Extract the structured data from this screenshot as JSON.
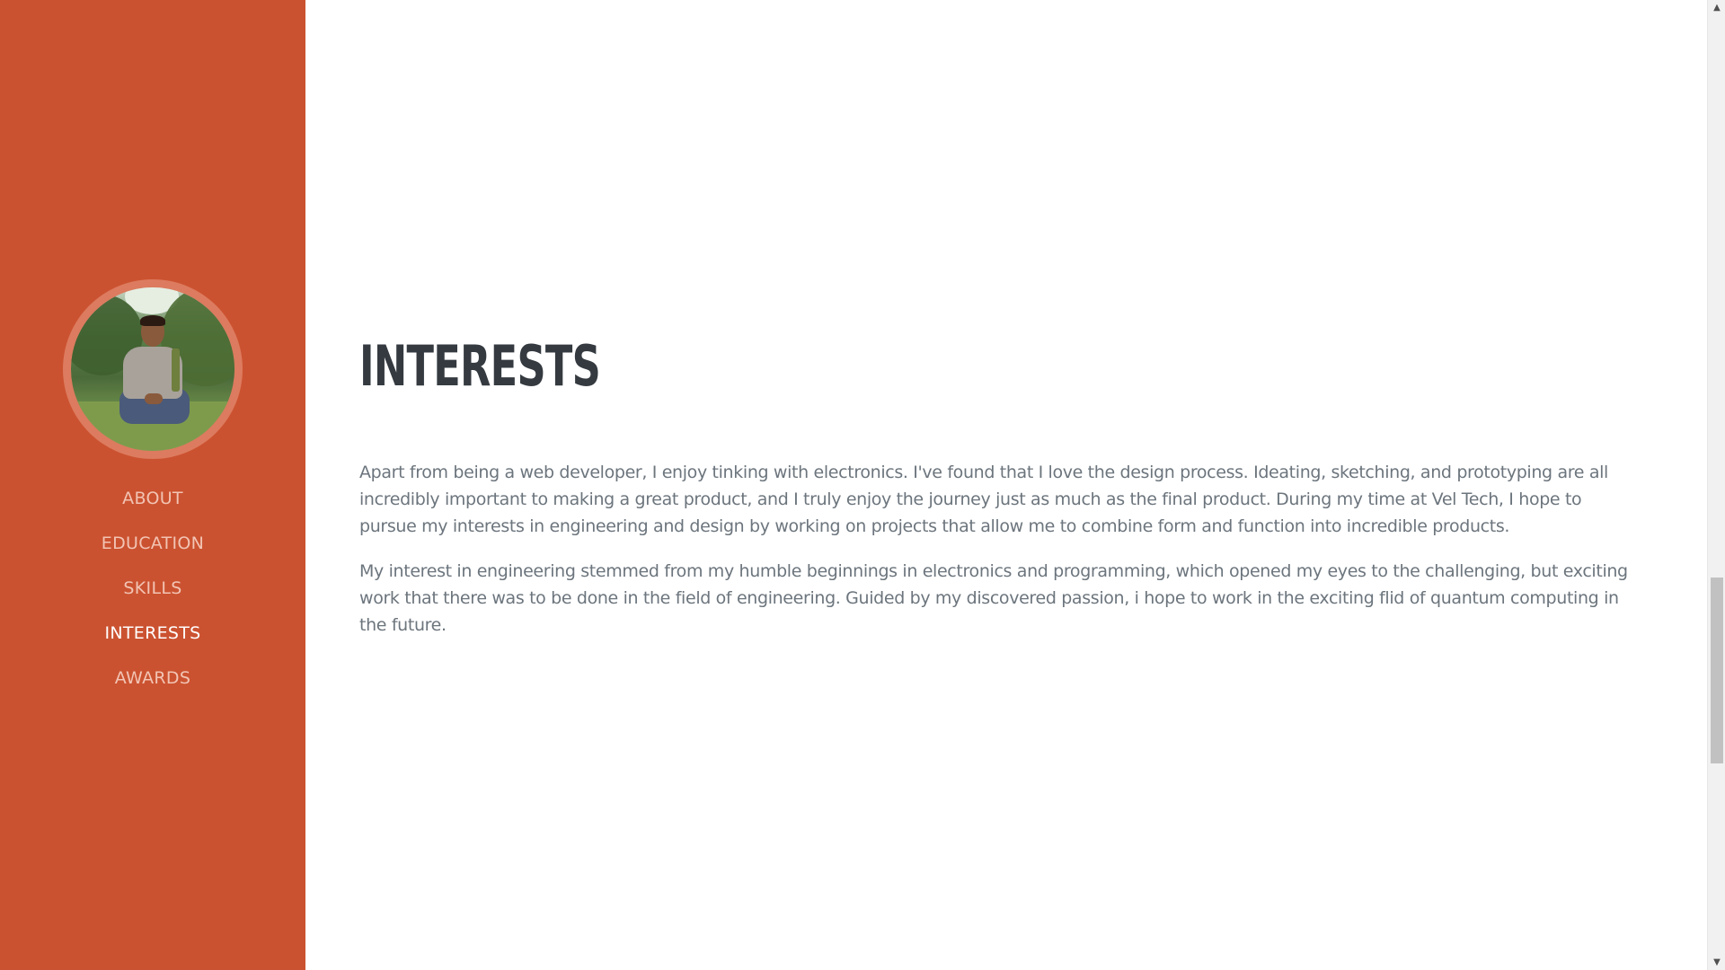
{
  "sidebar": {
    "background_color": "#cb5230",
    "avatar": {
      "alt": "profile photo",
      "ring_color": "#dc7b5f"
    },
    "nav": [
      {
        "label": "ABOUT",
        "active": false
      },
      {
        "label": "EDUCATION",
        "active": false
      },
      {
        "label": "SKILLS",
        "active": false
      },
      {
        "label": "INTERESTS",
        "active": true
      },
      {
        "label": "AWARDS",
        "active": false
      }
    ]
  },
  "main": {
    "section_title": "Interests",
    "paragraphs": [
      "Apart from being a web developer, I enjoy tinking with electronics. I've found that I love the design process. Ideating, sketching, and prototyping are all incredibly important to making a great product, and I truly enjoy the journey just as much as the final product. During my time at Vel Tech, I hope to pursue my interests in engineering and design by working on projects that allow me to combine form and function into incredible products.",
      "My interest in engineering stemmed from my humble beginnings in electronics and programming, which opened my eyes to the challenging, but exciting work that there was to be done in the field of engineering. Guided by my discovered passion, i hope to work in the exciting flid of quantum computing in the future."
    ],
    "title_color": "#343a40",
    "text_color": "#6c757d"
  },
  "scrollbar": {
    "up_icon": "arrow-up-icon",
    "down_icon": "arrow-down-icon"
  }
}
